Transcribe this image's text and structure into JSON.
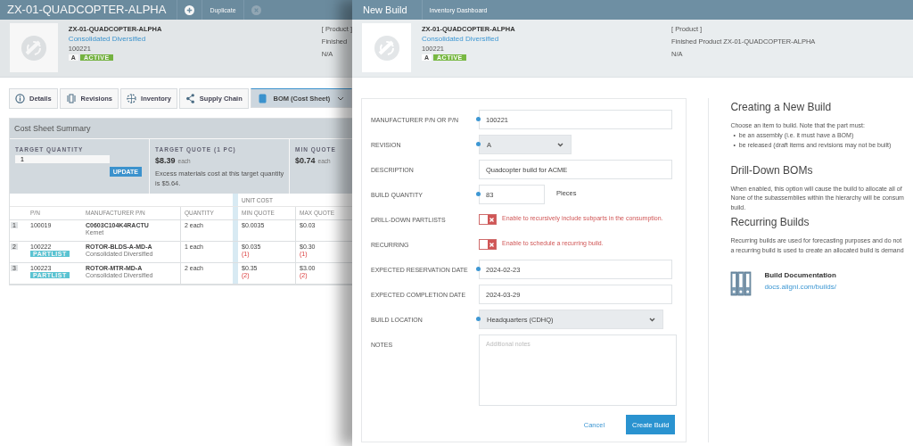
{
  "background_page": {
    "title": "ZX-01-QUADCOPTER-ALPHA",
    "actions": [
      {
        "kind": "add"
      },
      {
        "kind": "text",
        "label": "Duplicate"
      },
      {
        "kind": "close"
      }
    ],
    "item": {
      "name": "ZX-01-QUADCOPTER-ALPHA",
      "supplier": "Consolidated Diversified",
      "pn": "100221",
      "revision": "A",
      "status": "ACTIVE"
    },
    "item_meta": [
      "[ Product ]",
      "Finished",
      "N/A"
    ],
    "tabs": [
      {
        "label": "Details",
        "selected": false
      },
      {
        "label": "Revisions",
        "selected": false
      },
      {
        "label": "Inventory",
        "selected": false
      },
      {
        "label": "Supply Chain",
        "selected": false
      },
      {
        "label": "BOM (Cost Sheet)",
        "selected": true
      }
    ],
    "cost_sheet": {
      "title": "Cost Sheet Summary",
      "target_quantity": {
        "label": "TARGET QUANTITY",
        "value": "1",
        "button": "UPDATE"
      },
      "target_quote": {
        "label": "TARGET QUOTE (1 PC)",
        "price": "$8.39",
        "unit": "each",
        "note": "Excess materials cost at this target quantity is $5.64."
      },
      "min_quote": {
        "label": "MIN QUOTE",
        "price": "$0.74",
        "unit": "each"
      }
    },
    "table": {
      "group_header": "UNIT COST",
      "columns": [
        "P/N",
        "MANUFACTURER P/N",
        "QUANTITY",
        "MIN QUOTE",
        "MAX QUOTE"
      ],
      "rows": [
        {
          "index": "1",
          "pn": "100019",
          "mfr_pn": "C0603C104K4RACTU",
          "manufacturer": "Kemet",
          "quantity": "2 each",
          "min_quote": "$0.0035",
          "max_quote": "$0.03"
        },
        {
          "index": "2",
          "pn": "100222",
          "badge": "PARTLIST",
          "mfr_pn": "ROTOR-BLDS-A-MD-A",
          "manufacturer": "Consolidated Diversified",
          "quantity": "1 each",
          "min_quote": "$0.035",
          "min_note": "(1)",
          "max_quote": "$0.30",
          "max_note": "(1)"
        },
        {
          "index": "3",
          "pn": "100223",
          "badge": "PARTLIST",
          "mfr_pn": "ROTOR-MTR-MD-A",
          "manufacturer": "Consolidated Diversified",
          "quantity": "2 each",
          "min_quote": "$0.35",
          "min_note": "(2)",
          "max_quote": "$3.00",
          "max_note": "(2)"
        }
      ]
    }
  },
  "panel": {
    "title": "New Build",
    "tabs": [
      "Inventory Dashboard"
    ],
    "item": {
      "name": "ZX-01-QUADCOPTER-ALPHA",
      "supplier": "Consolidated Diversified",
      "pn": "100221",
      "revision": "A",
      "status": "ACTIVE"
    },
    "item_meta": [
      "[ Product ]",
      "Finished Product ZX-01-QUADCOPTER-ALPHA",
      "N/A"
    ],
    "form": {
      "fields": [
        {
          "kind": "text",
          "label": "MANUFACTURER P/N OR P/N",
          "required": true,
          "value": "100221"
        },
        {
          "kind": "picker",
          "label": "REVISION",
          "required": true,
          "value": "A"
        },
        {
          "kind": "text",
          "label": "DESCRIPTION",
          "required": false,
          "value": "Quadcopter build for ACME"
        },
        {
          "kind": "quantity",
          "label": "BUILD QUANTITY",
          "required": true,
          "value": "83",
          "unit": "Pieces"
        },
        {
          "kind": "toggle",
          "label": "DRILL-DOWN PARTLISTS",
          "on": false,
          "hint": "Enable to recursively include subparts in the consumption."
        },
        {
          "kind": "toggle",
          "label": "RECURRING",
          "on": false,
          "hint": "Enable to schedule a recurring build."
        },
        {
          "kind": "text",
          "label": "EXPECTED RESERVATION DATE",
          "required": true,
          "value": "2024-02-23"
        },
        {
          "kind": "text",
          "label": "EXPECTED COMPLETION DATE",
          "required": false,
          "value": "2024-03-29"
        },
        {
          "kind": "select",
          "label": "BUILD LOCATION",
          "required": true,
          "value": "Headquarters (CDHQ)"
        },
        {
          "kind": "textarea",
          "label": "NOTES",
          "required": false,
          "placeholder": "Additional notes"
        }
      ],
      "cancel": "Cancel",
      "submit": "Create Build"
    },
    "help": {
      "sections": [
        {
          "heading": "Creating a New Build",
          "lines": [
            "Choose an item to build. Note that the part must:"
          ],
          "bullets": [
            {
              "marker": "•",
              "text": "be an assembly (i.e. it must have a BOM)"
            },
            {
              "marker": "•",
              "text": "be released (draft items and revisions may not be built)"
            }
          ]
        },
        {
          "heading": "Drill-Down BOMs",
          "lines": [
            "When enabled, this option will cause the build to allocate all of",
            "None of the subassemblies within the hierarchy will be consum",
            "build."
          ]
        },
        {
          "heading": "Recurring Builds",
          "lines": [
            "Recurring builds are used for forecasting purposes and do not",
            "a recurring build is used to create an allocated build is demand"
          ]
        }
      ],
      "doc": {
        "title": "Build Documentation",
        "link": "docs.aligni.com/builds/"
      }
    }
  }
}
